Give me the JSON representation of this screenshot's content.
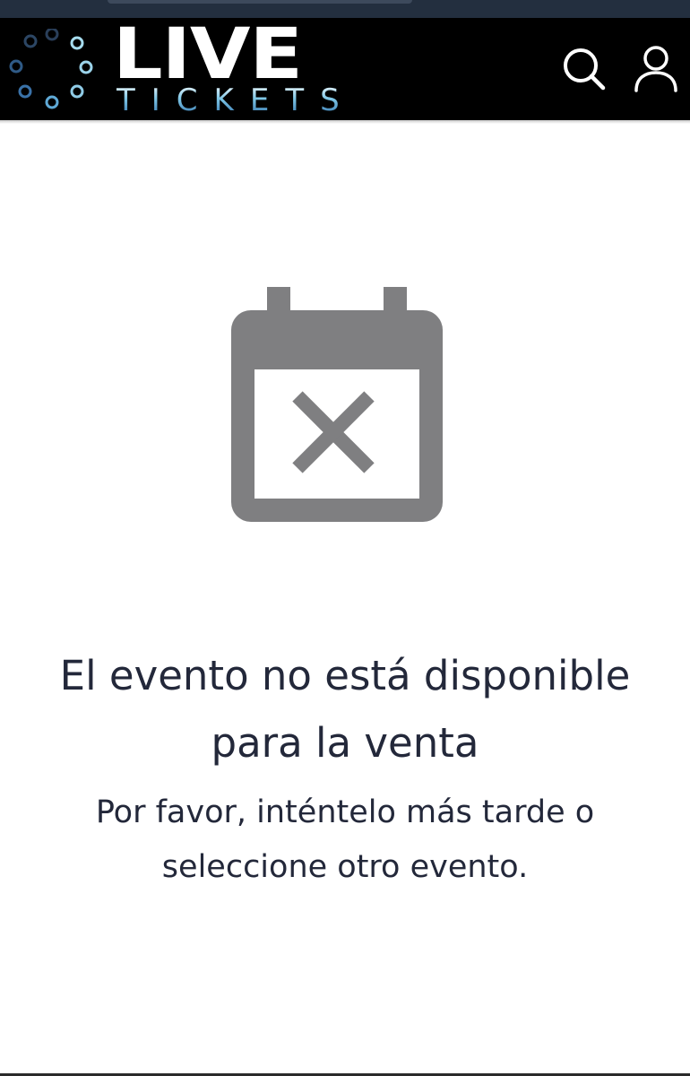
{
  "header": {
    "logo": {
      "word_top": "LIVE",
      "word_bottom": "TICKETS"
    },
    "search_icon": "search-icon",
    "user_icon": "user-icon"
  },
  "main": {
    "icon": "calendar-cancel-icon",
    "title_line1": "El evento no está disponible",
    "title_line2": "para la venta",
    "subtitle_line1": "Por favor, inténtelo más tarde o",
    "subtitle_line2": "seleccione otro evento."
  },
  "colors": {
    "header_bg": "#000000",
    "status_bar": "#232f3f",
    "icon_gray": "#7f7f81",
    "text": "#23283a",
    "logo_accent": "#5aa3d2"
  }
}
